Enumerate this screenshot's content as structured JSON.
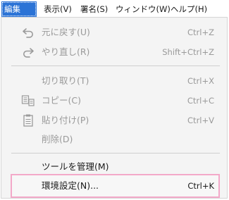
{
  "menubar": {
    "items": [
      {
        "label": "編集 (E)",
        "active": true
      },
      {
        "label": "表示(V)"
      },
      {
        "label": "署名(S)"
      },
      {
        "label": "ウィンドウ(W)"
      },
      {
        "label": "ヘルプ(H)"
      }
    ]
  },
  "menu": {
    "items": [
      {
        "label": "元に戻す(U)",
        "shortcut": "Ctrl+Z",
        "enabled": false,
        "icon": "undo-icon"
      },
      {
        "label": "やり直し(R)",
        "shortcut": "Shift+Ctrl+Z",
        "enabled": false,
        "icon": "redo-icon"
      },
      {
        "label": "切り取り(T)",
        "shortcut": "Ctrl+X",
        "enabled": false
      },
      {
        "label": "コピー(C)",
        "shortcut": "Ctrl+C",
        "enabled": false,
        "icon": "copy-icon"
      },
      {
        "label": "貼り付け(P)",
        "shortcut": "Ctrl+V",
        "enabled": false,
        "icon": "paste-icon"
      },
      {
        "label": "削除(D)",
        "shortcut": "",
        "enabled": false
      },
      {
        "label": "ツールを管理(M)",
        "shortcut": "",
        "enabled": true
      },
      {
        "label": "環境設定(N)...",
        "shortcut": "Ctrl+K",
        "enabled": true,
        "highlighted": true
      }
    ]
  },
  "colors": {
    "accent": "#2b73d6",
    "highlight_border": "#f3a9c9",
    "disabled_text": "#9a9a9a",
    "menu_bg": "#f4f4f4"
  }
}
